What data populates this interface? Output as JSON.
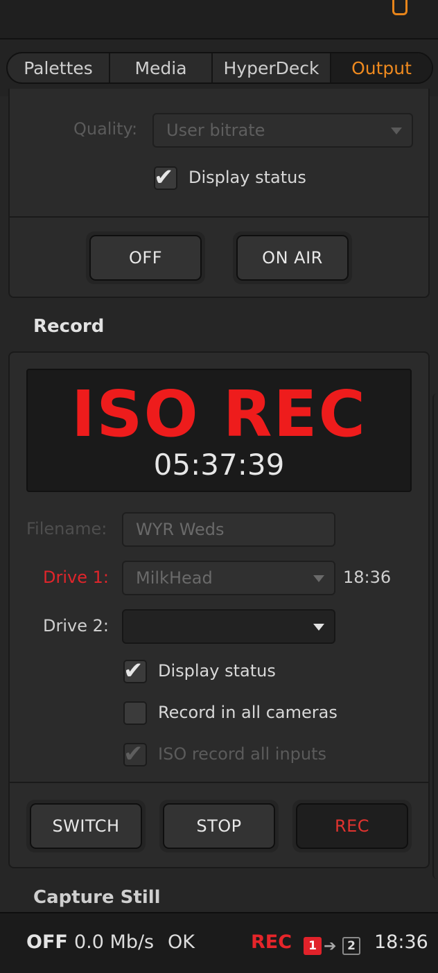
{
  "tabs": [
    {
      "label": "Palettes"
    },
    {
      "label": "Media"
    },
    {
      "label": "HyperDeck"
    },
    {
      "label": "Output",
      "active": true
    }
  ],
  "stream": {
    "quality_label": "Quality:",
    "quality_value": "User bitrate",
    "display_status_label": "Display status",
    "display_status_checked": true,
    "off_label": "OFF",
    "on_air_label": "ON AIR"
  },
  "record": {
    "heading": "Record",
    "status_title": "ISO REC",
    "timecode": "05:37:39",
    "filename_label": "Filename:",
    "filename_value": "WYR Weds",
    "drive1_label": "Drive 1:",
    "drive1_value": "MilkHead",
    "drive1_time": "18:36",
    "drive2_label": "Drive 2:",
    "drive2_value": "",
    "display_status_label": "Display status",
    "display_status_checked": true,
    "record_all_cameras_label": "Record in all cameras",
    "record_all_cameras_checked": false,
    "iso_all_inputs_label": "ISO record all inputs",
    "iso_all_inputs_checked": true,
    "switch_label": "SWITCH",
    "stop_label": "STOP",
    "rec_label": "REC"
  },
  "capture_still": {
    "heading": "Capture Still"
  },
  "footer": {
    "stream_state": "OFF",
    "bitrate": "0.0 Mb/s",
    "stream_health": "OK",
    "rec_state": "REC",
    "drive_active": "1",
    "drive_next": "2",
    "time_remaining": "18:36"
  },
  "colors": {
    "accent": "#ef8a1f",
    "rec_red": "#ee1c1c",
    "background": "#262626"
  }
}
